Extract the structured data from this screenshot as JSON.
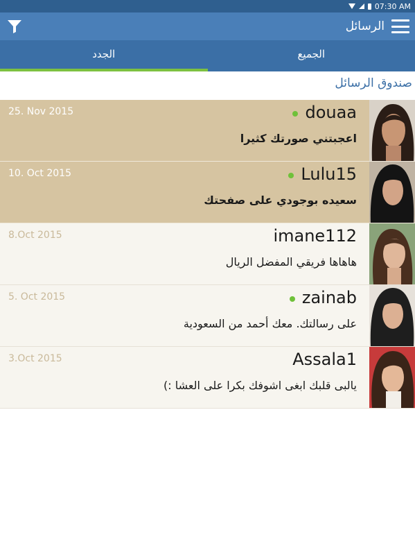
{
  "status_bar": {
    "time": "07:30 AM",
    "icons": [
      "wifi-icon",
      "signal-icon",
      "battery-icon"
    ]
  },
  "toolbar": {
    "title": "الرسائل",
    "menu_icon": "hamburger-icon",
    "filter_icon": "filter-icon"
  },
  "tabs": [
    {
      "label": "الجدد",
      "active": true
    },
    {
      "label": "الجميع",
      "active": false
    }
  ],
  "section_title": "صندوق الرسائل",
  "colors": {
    "toolbar": "#4a7fb8",
    "tabs": "#3b6fa6",
    "accent": "#7dc141",
    "unread_row": "#d6c4a1",
    "read_row": "#f7f5ef",
    "online": "#6fc13a"
  },
  "messages": [
    {
      "name": "douaa",
      "date": "25. Nov 2015",
      "text": "اعجبتني صورتك كثيرا",
      "online": true,
      "unread": true
    },
    {
      "name": "Lulu15",
      "date": "10. Oct 2015",
      "text": "سعيده بوجودي على صفحتك",
      "online": true,
      "unread": true
    },
    {
      "name": "imane112",
      "date": "8.Oct 2015",
      "text": "هاهاها فريقي المفضل الريال",
      "online": false,
      "unread": false
    },
    {
      "name": "zainab",
      "date": "5. Oct 2015",
      "text": "على رسالتك. معك أحمد من السعودية",
      "online": true,
      "unread": false
    },
    {
      "name": "Assala1",
      "date": "3.Oct 2015",
      "text": "يالبى قلبك ابغى اشوفك بكرا على العشا :)",
      "online": false,
      "unread": false
    }
  ]
}
